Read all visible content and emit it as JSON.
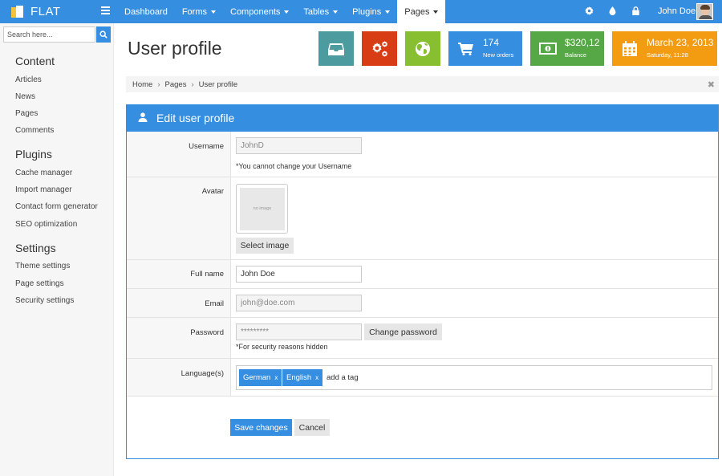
{
  "brand": {
    "name": "FLAT"
  },
  "nav": {
    "items": [
      {
        "label": "Dashboard",
        "caret": false
      },
      {
        "label": "Forms",
        "caret": true
      },
      {
        "label": "Components",
        "caret": true
      },
      {
        "label": "Tables",
        "caret": true
      },
      {
        "label": "Plugins",
        "caret": true
      },
      {
        "label": "Pages",
        "caret": true,
        "active": true
      }
    ]
  },
  "topbar": {
    "icons": [
      "gear-icon",
      "drop-icon",
      "lock-icon"
    ],
    "user_name": "John Doe"
  },
  "sidebar": {
    "search_placeholder": "Search here...",
    "sections": [
      {
        "title": "Content",
        "items": [
          "Articles",
          "News",
          "Pages",
          "Comments"
        ]
      },
      {
        "title": "Plugins",
        "items": [
          "Cache manager",
          "Import manager",
          "Contact form generator",
          "SEO optimization"
        ]
      },
      {
        "title": "Settings",
        "items": [
          "Theme settings",
          "Page settings",
          "Security settings"
        ]
      }
    ]
  },
  "page": {
    "title": "User profile"
  },
  "stats": {
    "orders": {
      "value": "174",
      "label": "New orders"
    },
    "balance": {
      "value": "$320,12",
      "label": "Balance"
    },
    "date": {
      "value": "March 23, 2013",
      "label": "Saturday, 11:28"
    }
  },
  "tile_colors": {
    "inbox": "#4b9b9f",
    "settings": "#d83c14",
    "globe": "#88bf30",
    "orders": "#368ee0",
    "balance": "#56a846",
    "date": "#f39c12"
  },
  "breadcrumb": {
    "items": [
      "Home",
      "Pages",
      "User profile"
    ]
  },
  "form": {
    "title": "Edit user profile",
    "username": {
      "label": "Username",
      "value": "JohnD",
      "hint": "*You cannot change your Username"
    },
    "avatar": {
      "label": "Avatar",
      "placeholder": "no image",
      "button": "Select image"
    },
    "fullname": {
      "label": "Full name",
      "value": "John Doe"
    },
    "email": {
      "label": "Email",
      "value": "john@doe.com"
    },
    "password": {
      "label": "Password",
      "value": "*********",
      "button": "Change password",
      "hint": "*For security reasons hidden"
    },
    "languages": {
      "label": "Language(s)",
      "tags": [
        "German",
        "English"
      ],
      "tag_remove": "x",
      "placeholder": "add a tag"
    },
    "save": "Save changes",
    "cancel": "Cancel"
  }
}
